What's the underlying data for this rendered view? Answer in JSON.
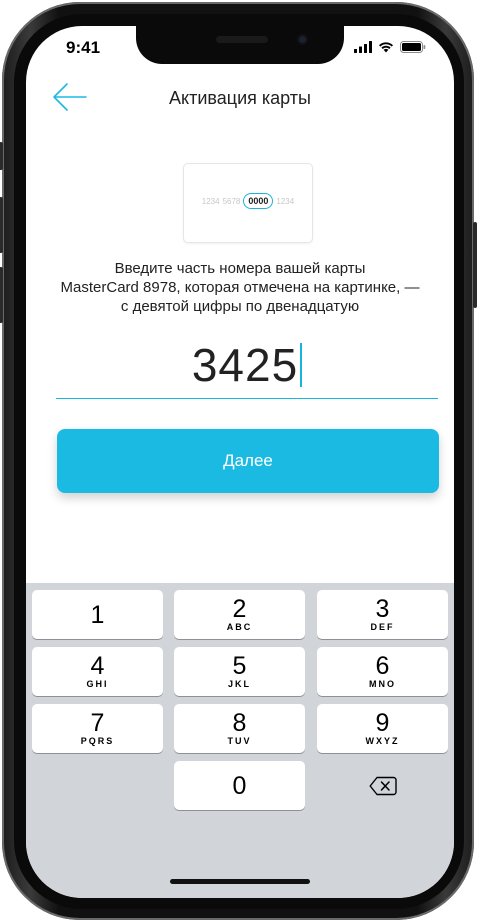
{
  "status_bar": {
    "time": "9:41"
  },
  "nav": {
    "title": "Активация карты",
    "back_icon": "arrow-left-icon"
  },
  "card_illustration": {
    "groups": [
      "1234",
      "5678",
      "0000",
      "1234"
    ],
    "highlight_index": 2
  },
  "instruction": {
    "line1": "Введите часть номера вашей карты",
    "line2": "MasterCard 8978, которая отмечена на картинке, —",
    "line3": "с девятой цифры по двенадцатую"
  },
  "code_input": {
    "value": "3425"
  },
  "next_button": {
    "label": "Далее"
  },
  "keyboard": {
    "keys": [
      {
        "num": "1",
        "letters": ""
      },
      {
        "num": "2",
        "letters": "ABC"
      },
      {
        "num": "3",
        "letters": "DEF"
      },
      {
        "num": "4",
        "letters": "GHI"
      },
      {
        "num": "5",
        "letters": "JKL"
      },
      {
        "num": "6",
        "letters": "MNO"
      },
      {
        "num": "7",
        "letters": "PQRS"
      },
      {
        "num": "8",
        "letters": "TUV"
      },
      {
        "num": "9",
        "letters": "WXYZ"
      },
      {
        "num": "0",
        "letters": ""
      }
    ],
    "delete_icon": "backspace-icon"
  },
  "colors": {
    "accent": "#1bbae3",
    "keyboard_bg": "#d1d4d9"
  }
}
